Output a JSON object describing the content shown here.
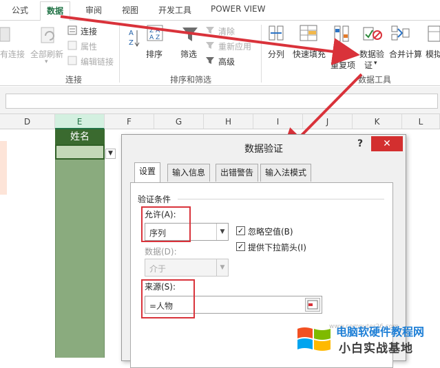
{
  "ribbon_tabs": [
    "公式",
    "数据",
    "审阅",
    "视图",
    "开发工具",
    "POWER VIEW"
  ],
  "active_tab": "数据",
  "ribbon": {
    "conn_partial": "有连接",
    "refresh_all": "全部刷新",
    "connections": "连接",
    "properties": "属性",
    "edit_links": "编辑链接",
    "group_connections": "连接",
    "sort_az": "A Z",
    "sort": "排序",
    "filter": "筛选",
    "clear": "清除",
    "reapply": "重新应用",
    "advanced": "高级",
    "group_sort_filter": "排序和筛选",
    "split": "分列",
    "flash_fill": "快速填充",
    "remove_dup_1": "删除",
    "remove_dup_2": "重复项",
    "data_validation_1": "数据验",
    "data_validation_2": "证",
    "consolidate": "合并计算",
    "whatif_partial": "模拟",
    "group_data_tools": "数据工具"
  },
  "columns": [
    "D",
    "E",
    "F",
    "G",
    "H",
    "I",
    "J",
    "K",
    "L"
  ],
  "selected_column": "E",
  "name_header": "姓名",
  "dialog": {
    "title": "数据验证",
    "help": "?",
    "close": "✕",
    "tabs": [
      "设置",
      "输入信息",
      "出错警告",
      "输入法模式"
    ],
    "section": "验证条件",
    "allow_label": "允许(A):",
    "allow_value": "序列",
    "ignore_blank": "忽略空值(B)",
    "show_dropdown": "提供下拉箭头(I)",
    "data_label": "数据(D):",
    "data_value": "介于",
    "source_label": "来源(S):",
    "source_value": "=人物"
  },
  "watermark": {
    "line1": "电脑软硬件教程网",
    "line2": "小白实战基地",
    "url": "www.computer26.com"
  },
  "colors": {
    "excel_green": "#217346",
    "annotation_red": "#d9323a",
    "close_red": "#d32f2f"
  }
}
